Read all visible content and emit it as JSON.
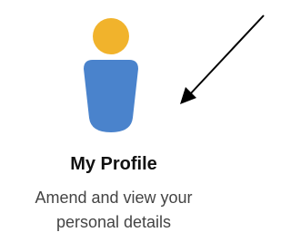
{
  "profile_card": {
    "icon": "user-profile-icon",
    "title": "My Profile",
    "description_line1": "Amend and view your",
    "description_line2": "personal details"
  },
  "annotation": {
    "icon": "pointer-arrow-icon"
  },
  "colors": {
    "head": "#F1B32C",
    "body": "#4A83CC",
    "title_text": "#111111",
    "description_text": "#444444",
    "arrow": "#000000"
  }
}
